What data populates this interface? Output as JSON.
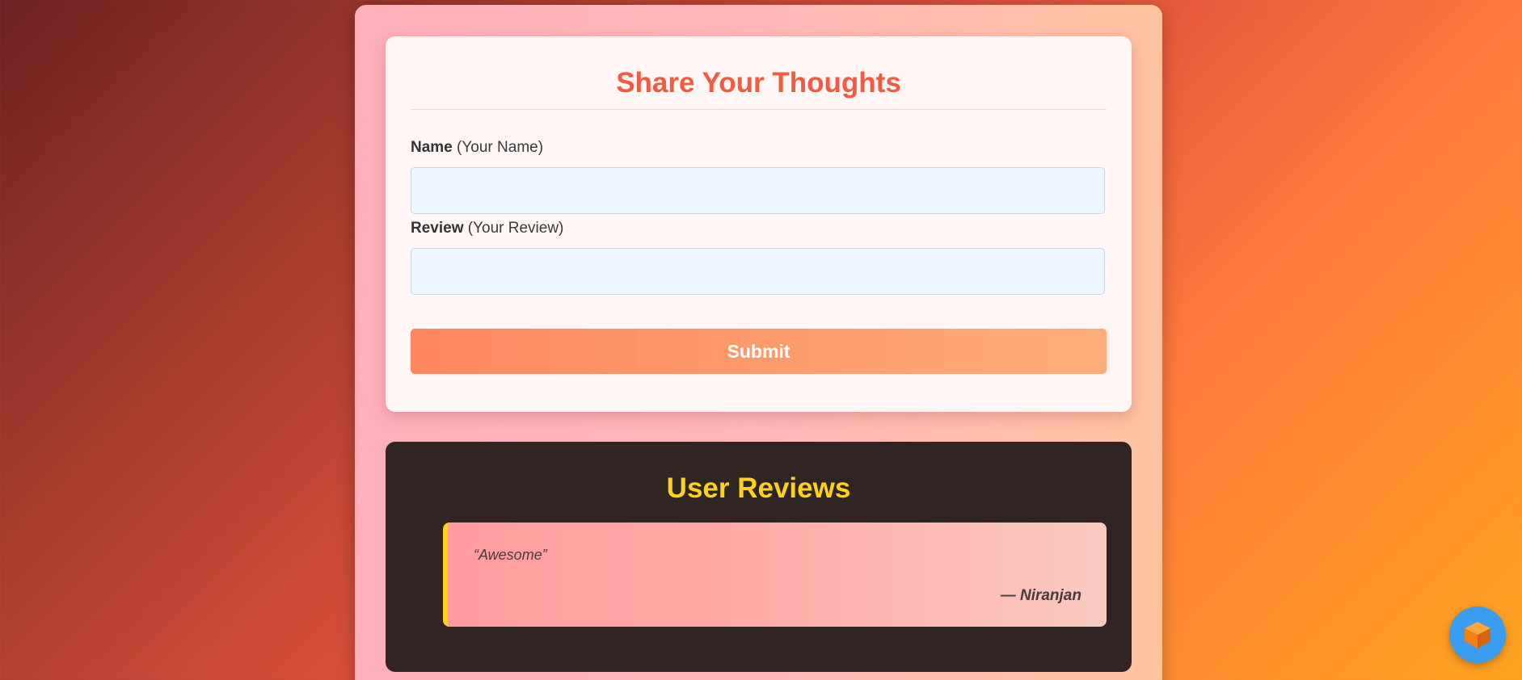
{
  "form": {
    "title": "Share Your Thoughts",
    "name_label_bold": "Name",
    "name_label_hint": "(Your Name)",
    "name_value": "",
    "review_label_bold": "Review",
    "review_label_hint": "(Your Review)",
    "review_value": "",
    "submit_label": "Submit"
  },
  "reviews": {
    "title": "User Reviews",
    "items": [
      {
        "text": "“Awesome”",
        "author": "— Niranjan"
      }
    ]
  },
  "fab": {
    "icon": "cube-icon"
  },
  "colors": {
    "form_title": "#f25b42",
    "reviews_title": "#ffd21a",
    "fab": "#3b9df0"
  }
}
